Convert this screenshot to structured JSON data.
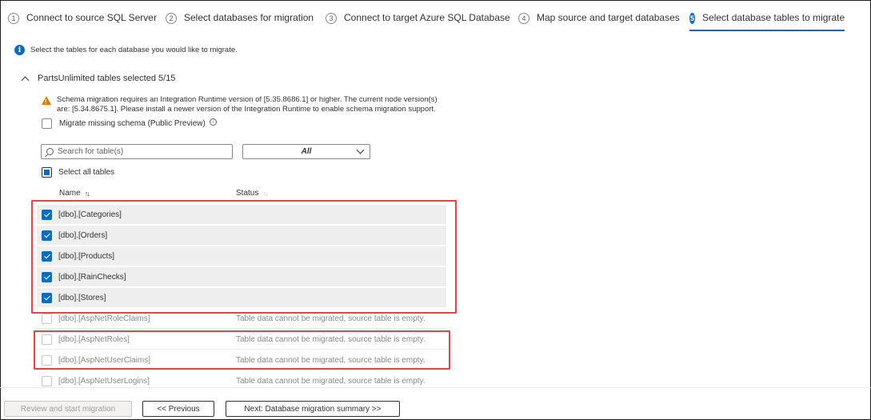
{
  "wizard": {
    "steps": [
      {
        "num": "1",
        "label": "Connect to source SQL Server"
      },
      {
        "num": "2",
        "label": "Select databases for migration"
      },
      {
        "num": "3",
        "label": "Connect to target Azure SQL Database"
      },
      {
        "num": "4",
        "label": "Map source and target databases"
      },
      {
        "num": "5",
        "label": "Select database tables to migrate",
        "active": true
      }
    ]
  },
  "info_text": "Select the tables for each database you would like to migrate.",
  "section": {
    "title": "PartsUnlimited tables selected 5/15",
    "warning_line1": "Schema migration requires an Integration Runtime version of [5.35.8686.1] or higher. The current node version(s)",
    "warning_line2": "are: [5.34.8675.1]. Please install a newer version of the Integration Runtime to enable schema migration support.",
    "schema_label": "Migrate missing schema (Public Preview)",
    "search_placeholder": "Search for table(s)",
    "filter_value": "All",
    "select_all_label": "Select all tables",
    "col_name": "Name",
    "col_status": "Status",
    "sort_glyph": "↑↓"
  },
  "tables": [
    {
      "name": "[dbo].[Categories]",
      "status": "",
      "checked": true
    },
    {
      "name": "[dbo].[Orders]",
      "status": "",
      "checked": true
    },
    {
      "name": "[dbo].[Products]",
      "status": "",
      "checked": true
    },
    {
      "name": "[dbo].[RainChecks]",
      "status": "",
      "checked": true
    },
    {
      "name": "[dbo].[Stores]",
      "status": "",
      "checked": true
    },
    {
      "name": "[dbo].[AspNetRoleClaims]",
      "status": "Table data cannot be migrated, source table is empty.",
      "checked": false
    },
    {
      "name": "[dbo].[AspNetRoles]",
      "status": "Table data cannot be migrated, source table is empty.",
      "checked": false
    },
    {
      "name": "[dbo].[AspNetUserClaims]",
      "status": "Table data cannot be migrated, source table is empty.",
      "checked": false
    },
    {
      "name": "[dbo].[AspNetUserLogins]",
      "status": "Table data cannot be migrated, source table is empty.",
      "checked": false
    }
  ],
  "footer": {
    "review_label": "Review and start migration",
    "previous_label": "<< Previous",
    "next_label": "Next: Database migration summary >>"
  },
  "colors": {
    "accent": "#0f6cbd",
    "highlight": "#e0474c",
    "warning": "#d97b0c"
  }
}
